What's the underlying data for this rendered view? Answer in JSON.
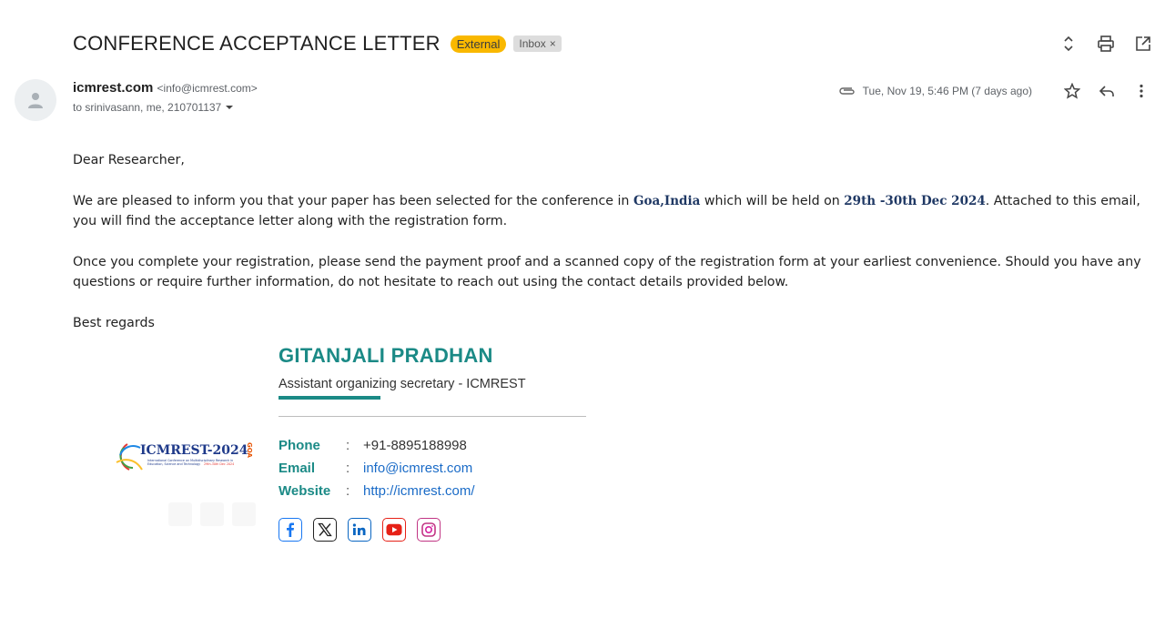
{
  "email": {
    "subject": "CONFERENCE ACCEPTANCE LETTER",
    "badge_external": "External",
    "label_inbox": "Inbox",
    "label_close": "×",
    "sender_name": "icmrest.com",
    "sender_email": "<info@icmrest.com>",
    "recipients": "to srinivasann, me, 210701137",
    "date": "Tue, Nov 19, 5:46 PM (7 days ago)"
  },
  "body": {
    "greeting": "Dear Researcher,",
    "p1_before": "We are pleased to inform you that your paper has been selected for the conference in ",
    "p1_location": "Goa,India",
    "p1_middle": " which will be held on ",
    "p1_dates": "29th -30th Dec 2024",
    "p1_after": ". Attached to this email, you will find the acceptance letter along with the registration form.",
    "p2": "Once you complete your registration, please send the payment proof and a scanned copy of the registration form at your earliest convenience. Should you have any questions or require further information, do not hesitate to reach out using the contact details provided below.",
    "closing": "Best regards"
  },
  "signature": {
    "name": "GITANJALI PRADHAN",
    "title": "Assistant organizing secretary - ICMREST",
    "phone_label": "Phone",
    "phone": "+91-8895188998",
    "email_label": "Email",
    "email": "info@icmrest.com",
    "website_label": "Website",
    "website": "http://icmrest.com/",
    "separator": ":",
    "logo_text": "ICMREST-2024",
    "logo_side": "GOA",
    "logo_sub1": "International Conference on Multidisciplinary Research in",
    "logo_sub2": "Education, Science and Technology",
    "logo_sub3": "29th-30th Dec 2024"
  },
  "colors": {
    "accent": "#1b8a86",
    "link": "#1a6bc7",
    "badge": "#f9b800"
  },
  "icons": [
    "unfold-icon",
    "print-icon",
    "open-in-new-icon",
    "attachment-icon",
    "star-icon",
    "reply-icon",
    "more-vert-icon",
    "facebook-icon",
    "x-icon",
    "linkedin-icon",
    "youtube-icon",
    "instagram-icon"
  ]
}
